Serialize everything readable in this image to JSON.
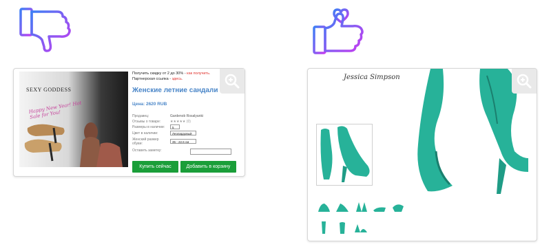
{
  "colors": {
    "accent_blue": "#4a86c8",
    "promo_red": "#e0312c",
    "button_green": "#1a9e39",
    "shoe_teal": "#27b299",
    "icon_gradient_start": "#3d7ff5",
    "icon_gradient_end": "#c83cf0"
  },
  "icons": {
    "dislike": "thumbs-down-icon",
    "like": "thumbs-up-heart-icon",
    "zoom": "zoom-in-icon"
  },
  "bad_example": {
    "banner": {
      "title": "SEXY GODDESS",
      "script": "Happy New Year! Hot Sale for You!"
    },
    "promo_line1": "Получить скидку от 2 до 30% - ",
    "promo_link1": "как получить.",
    "promo_line2": "Партнерская ссылка - ",
    "promo_link2": "здесь.",
    "product_title": "Женские летние сандали",
    "price": "Цена: 2620 RUB",
    "specs": [
      {
        "label": "Продавец:",
        "value": "Gardenob Rosalyanki"
      },
      {
        "label": "Отзывы о товаре:",
        "value": "★★★★★ (0)"
      },
      {
        "label": "Размеры в наличии:",
        "value": "5"
      },
      {
        "label": "Цвет в наличии:",
        "value": "Леопардовый"
      },
      {
        "label": "Женский размер обуви:",
        "value": "35 - 22.6 см"
      },
      {
        "label": "Оставить заметку:",
        "value": ""
      }
    ],
    "buy_button": "Купить сейчас",
    "cart_button": "Добавить в корзину"
  },
  "good_example": {
    "logo": "Jessica Simpson"
  }
}
